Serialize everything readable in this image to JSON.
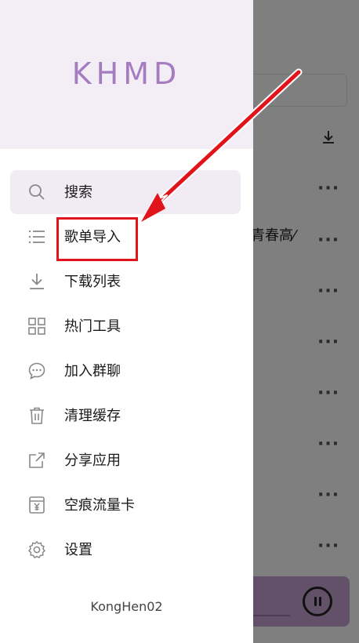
{
  "drawer": {
    "title": "KHMD",
    "items": [
      {
        "label": "搜索",
        "icon": "search-icon"
      },
      {
        "label": "歌单导入",
        "icon": "list-icon"
      },
      {
        "label": "下载列表",
        "icon": "download-icon"
      },
      {
        "label": "热门工具",
        "icon": "grid-icon"
      },
      {
        "label": "加入群聊",
        "icon": "chat-bubble-icon"
      },
      {
        "label": "清理缓存",
        "icon": "trash-icon"
      },
      {
        "label": "分享应用",
        "icon": "share-icon"
      },
      {
        "label": "空痕流量卡",
        "icon": "sim-card-icon"
      },
      {
        "label": "设置",
        "icon": "gear-icon"
      }
    ],
    "footer": "KongHen02"
  },
  "background": {
    "partial_text": "青春高⁄"
  },
  "colors": {
    "accent": "#a67cc0",
    "header_bg": "#f3eef5",
    "annotation": "#e0141a",
    "player_bg": "#c5a2d0"
  }
}
